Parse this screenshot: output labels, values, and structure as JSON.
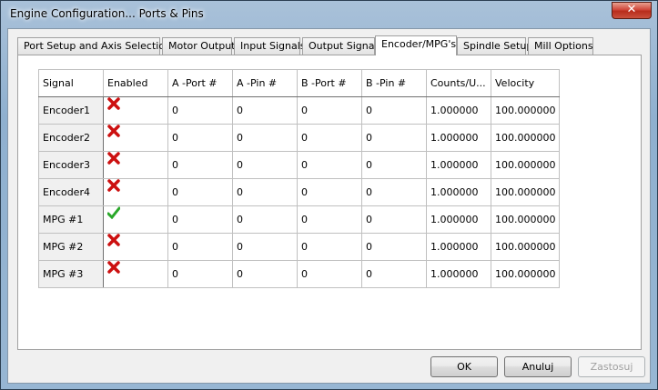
{
  "window": {
    "title": "Engine Configuration... Ports & Pins",
    "close_label": "✕"
  },
  "tabs": [
    "Port Setup and Axis Selection",
    "Motor Outputs",
    "Input Signals",
    "Output Signals",
    "Encoder/MPG's",
    "Spindle Setup",
    "Mill Options"
  ],
  "active_tab": "Encoder/MPG's",
  "grid": {
    "columns": [
      "Signal",
      "Enabled",
      "A -Port #",
      "A -Pin  #",
      "B -Port #",
      "B -Pin  #",
      "Counts/U...",
      "Velocity"
    ],
    "rows": [
      {
        "signal": "Encoder1",
        "enabled": false,
        "a_port": "0",
        "a_pin": "0",
        "b_port": "0",
        "b_pin": "0",
        "counts": "1.000000",
        "velocity": "100.000000"
      },
      {
        "signal": "Encoder2",
        "enabled": false,
        "a_port": "0",
        "a_pin": "0",
        "b_port": "0",
        "b_pin": "0",
        "counts": "1.000000",
        "velocity": "100.000000"
      },
      {
        "signal": "Encoder3",
        "enabled": false,
        "a_port": "0",
        "a_pin": "0",
        "b_port": "0",
        "b_pin": "0",
        "counts": "1.000000",
        "velocity": "100.000000"
      },
      {
        "signal": "Encoder4",
        "enabled": false,
        "a_port": "0",
        "a_pin": "0",
        "b_port": "0",
        "b_pin": "0",
        "counts": "1.000000",
        "velocity": "100.000000"
      },
      {
        "signal": "MPG #1",
        "enabled": true,
        "a_port": "0",
        "a_pin": "0",
        "b_port": "0",
        "b_pin": "0",
        "counts": "1.000000",
        "velocity": "100.000000"
      },
      {
        "signal": "MPG #2",
        "enabled": false,
        "a_port": "0",
        "a_pin": "0",
        "b_port": "0",
        "b_pin": "0",
        "counts": "1.000000",
        "velocity": "100.000000"
      },
      {
        "signal": "MPG #3",
        "enabled": false,
        "a_port": "0",
        "a_pin": "0",
        "b_port": "0",
        "b_pin": "0",
        "counts": "1.000000",
        "velocity": "100.000000"
      }
    ]
  },
  "buttons": {
    "ok": "OK",
    "cancel": "Anuluj",
    "apply": "Zastosuj"
  },
  "icons": {
    "enabled_true": "green-check-icon",
    "enabled_false": "red-x-icon"
  },
  "colors": {
    "check": "#2aa82a",
    "cross": "#cc1010"
  }
}
